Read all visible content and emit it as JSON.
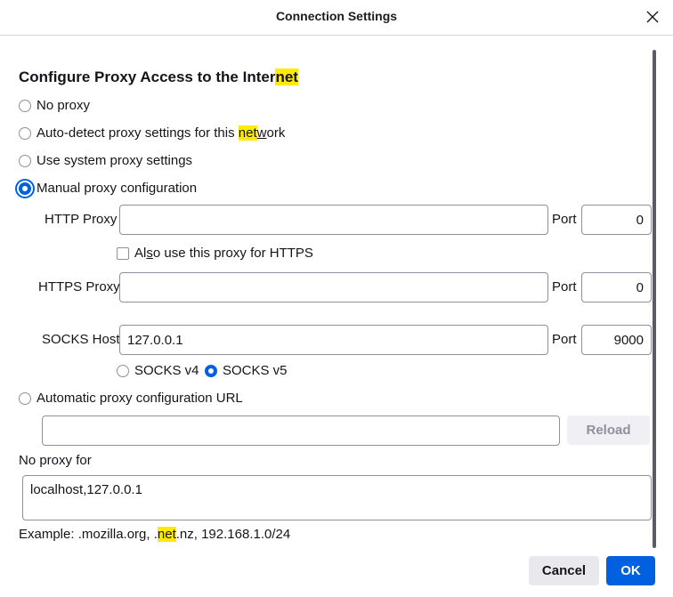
{
  "dialog": {
    "title": "Connection Settings"
  },
  "section": {
    "heading_pre": "Configure Proxy Access to the Inter",
    "heading_hl": "net"
  },
  "proxy_options": {
    "no_proxy": "No proxy",
    "auto_detect_pre": "Auto-detect proxy settings for this ",
    "auto_detect_hl": "net",
    "auto_detect_post_u": "w",
    "auto_detect_post": "ork",
    "use_system": "Use system proxy settings",
    "manual": "Manual proxy configuration",
    "automatic_url": "Automatic proxy configuration URL",
    "selected": "manual"
  },
  "http": {
    "label": "HTTP Proxy",
    "value": "",
    "port_label": "Port",
    "port_value": "0"
  },
  "also_https": {
    "label_pre": "Al",
    "label_u": "s",
    "label_post": "o use this proxy for HTTPS",
    "checked": false
  },
  "https": {
    "label": "HTTPS Proxy",
    "value": "",
    "port_label": "Port",
    "port_value": "0"
  },
  "socks": {
    "label": "SOCKS Host",
    "value": "127.0.0.1",
    "port_label": "Port",
    "port_value": "9000",
    "v4_label": "SOCKS v4",
    "v5_label": "SOCKS v5",
    "selected_version": "v5"
  },
  "autoconfig": {
    "url_value": "",
    "reload_label": "Reload"
  },
  "no_proxy_for": {
    "label": "No proxy for",
    "value": "localhost,127.0.0.1"
  },
  "example": {
    "pre": "Example: .mozilla.org, .",
    "hl": "net",
    "post": ".nz, 192.168.1.0/24"
  },
  "buttons": {
    "cancel": "Cancel",
    "ok": "OK"
  },
  "colors": {
    "accent": "#0061e0",
    "highlight": "#ffea00"
  }
}
